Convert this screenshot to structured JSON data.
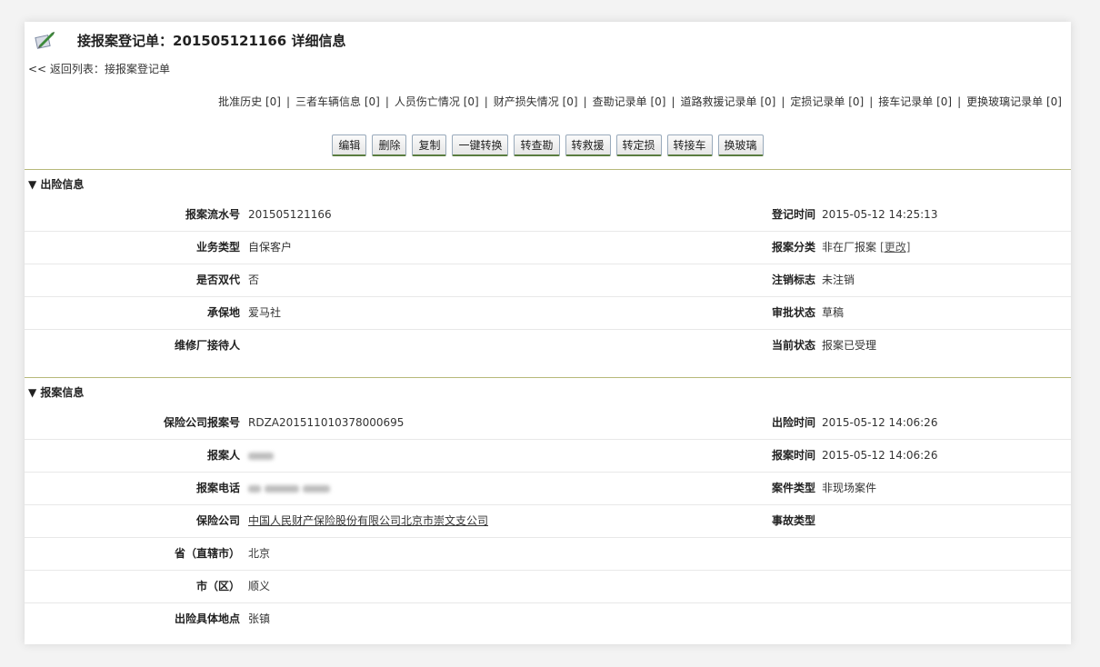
{
  "header": {
    "title": "接报案登记单：201505121166 详细信息",
    "back_prefix": "<< 返回列表：",
    "back_link": "接报案登记单"
  },
  "nav_links": [
    "批准历史 [0]",
    "三者车辆信息 [0]",
    "人员伤亡情况 [0]",
    "财产损失情况 [0]",
    "查勘记录单 [0]",
    "道路救援记录单 [0]",
    "定损记录单 [0]",
    "接车记录单 [0]",
    "更换玻璃记录单 [0]"
  ],
  "buttons": [
    "编辑",
    "删除",
    "复制",
    "一键转换",
    "转查勘",
    "转救援",
    "转定损",
    "转接车",
    "换玻璃"
  ],
  "section1": {
    "title": "▼ 出险信息",
    "report_serial_label": "报案流水号",
    "report_serial": "201505121166",
    "register_time_label": "登记时间",
    "register_time": "2015-05-12 14:25:13",
    "biz_type_label": "业务类型",
    "biz_type": "自保客户",
    "report_class_label": "报案分类",
    "report_class": "非在厂报案",
    "report_class_edit": "[更改]",
    "dual_label": "是否双代",
    "dual": "否",
    "cancel_label": "注销标志",
    "cancel": "未注销",
    "underwriter_label": "承保地",
    "underwriter": "爱马社",
    "approval_label": "审批状态",
    "approval": "草稿",
    "receiver_label": "维修厂接待人",
    "receiver": "",
    "status_label": "当前状态",
    "status": "报案已受理"
  },
  "section2": {
    "title": "▼ 报案信息",
    "ins_report_no_label": "保险公司报案号",
    "ins_report_no": "RDZA201511010378000695",
    "accident_time_label": "出险时间",
    "accident_time": "2015-05-12 14:06:26",
    "reporter_label": "报案人",
    "report_time_label": "报案时间",
    "report_time": "2015-05-12 14:06:26",
    "phone_label": "报案电话",
    "case_type_label": "案件类型",
    "case_type": "非现场案件",
    "insurer_label": "保险公司",
    "insurer": "中国人民财产保险股份有限公司北京市崇文支公司",
    "accident_type_label": "事故类型",
    "accident_type": "",
    "province_label": "省（直辖市）",
    "province": "北京",
    "city_label": "市（区）",
    "city": "顺义",
    "location_label": "出险具体地点",
    "location": "张镇"
  }
}
